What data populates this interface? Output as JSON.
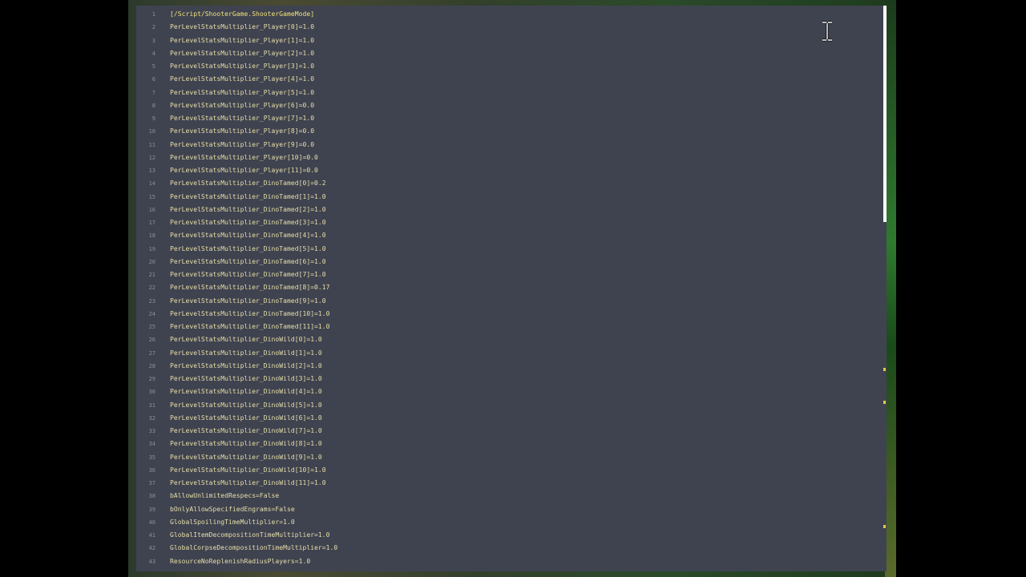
{
  "editor": {
    "lines": [
      {
        "no": "1",
        "text": "[/Script/ShooterGame.ShooterGameMode]"
      },
      {
        "no": "2",
        "text": "PerLevelStatsMultiplier_Player[0]=1.0"
      },
      {
        "no": "3",
        "text": "PerLevelStatsMultiplier_Player[1]=1.0"
      },
      {
        "no": "4",
        "text": "PerLevelStatsMultiplier_Player[2]=1.0"
      },
      {
        "no": "5",
        "text": "PerLevelStatsMultiplier_Player[3]=1.0"
      },
      {
        "no": "6",
        "text": "PerLevelStatsMultiplier_Player[4]=1.0"
      },
      {
        "no": "7",
        "text": "PerLevelStatsMultiplier_Player[5]=1.0"
      },
      {
        "no": "8",
        "text": "PerLevelStatsMultiplier_Player[6]=0.0"
      },
      {
        "no": "9",
        "text": "PerLevelStatsMultiplier_Player[7]=1.0"
      },
      {
        "no": "10",
        "text": "PerLevelStatsMultiplier_Player[8]=0.0"
      },
      {
        "no": "11",
        "text": "PerLevelStatsMultiplier_Player[9]=0.0"
      },
      {
        "no": "12",
        "text": "PerLevelStatsMultiplier_Player[10]=0.0"
      },
      {
        "no": "13",
        "text": "PerLevelStatsMultiplier_Player[11]=0.0"
      },
      {
        "no": "14",
        "text": "PerLevelStatsMultiplier_DinoTamed[0]=0.2"
      },
      {
        "no": "15",
        "text": "PerLevelStatsMultiplier_DinoTamed[1]=1.0"
      },
      {
        "no": "16",
        "text": "PerLevelStatsMultiplier_DinoTamed[2]=1.0"
      },
      {
        "no": "17",
        "text": "PerLevelStatsMultiplier_DinoTamed[3]=1.0"
      },
      {
        "no": "18",
        "text": "PerLevelStatsMultiplier_DinoTamed[4]=1.0"
      },
      {
        "no": "19",
        "text": "PerLevelStatsMultiplier_DinoTamed[5]=1.0"
      },
      {
        "no": "20",
        "text": "PerLevelStatsMultiplier_DinoTamed[6]=1.0"
      },
      {
        "no": "21",
        "text": "PerLevelStatsMultiplier_DinoTamed[7]=1.0"
      },
      {
        "no": "22",
        "text": "PerLevelStatsMultiplier_DinoTamed[8]=0.17"
      },
      {
        "no": "23",
        "text": "PerLevelStatsMultiplier_DinoTamed[9]=1.0"
      },
      {
        "no": "24",
        "text": "PerLevelStatsMultiplier_DinoTamed[10]=1.0"
      },
      {
        "no": "25",
        "text": "PerLevelStatsMultiplier_DinoTamed[11]=1.0"
      },
      {
        "no": "26",
        "text": "PerLevelStatsMultiplier_DinoWild[0]=1.0"
      },
      {
        "no": "27",
        "text": "PerLevelStatsMultiplier_DinoWild[1]=1.0"
      },
      {
        "no": "28",
        "text": "PerLevelStatsMultiplier_DinoWild[2]=1.0"
      },
      {
        "no": "29",
        "text": "PerLevelStatsMultiplier_DinoWild[3]=1.0"
      },
      {
        "no": "30",
        "text": "PerLevelStatsMultiplier_DinoWild[4]=1.0"
      },
      {
        "no": "31",
        "text": "PerLevelStatsMultiplier_DinoWild[5]=1.0"
      },
      {
        "no": "32",
        "text": "PerLevelStatsMultiplier_DinoWild[6]=1.0"
      },
      {
        "no": "33",
        "text": "PerLevelStatsMultiplier_DinoWild[7]=1.0"
      },
      {
        "no": "34",
        "text": "PerLevelStatsMultiplier_DinoWild[8]=1.0"
      },
      {
        "no": "35",
        "text": "PerLevelStatsMultiplier_DinoWild[9]=1.0"
      },
      {
        "no": "36",
        "text": "PerLevelStatsMultiplier_DinoWild[10]=1.0"
      },
      {
        "no": "37",
        "text": "PerLevelStatsMultiplier_DinoWild[11]=1.0"
      },
      {
        "no": "38",
        "text": "bAllowUnlimitedRespecs=False"
      },
      {
        "no": "39",
        "text": "bOnlyAllowSpecifiedEngrams=False"
      },
      {
        "no": "40",
        "text": "GlobalSpoilingTimeMultiplier=1.0"
      },
      {
        "no": "41",
        "text": "GlobalItemDecompositionTimeMultiplier=1.0"
      },
      {
        "no": "42",
        "text": "GlobalCorpseDecompositionTimeMultiplier=1.0"
      },
      {
        "no": "43",
        "text": "ResourceNoReplenishRadiusPlayers=1.0"
      }
    ]
  },
  "colors": {
    "editor_background": "#3f4350",
    "code_text": "#e8dfa8",
    "line_number": "#8a8e9b",
    "scrollbar_thumb": "#ffffff",
    "scroll_marker": "#e6c84a"
  },
  "icons": {
    "cursor": "text-cursor-ibeam-icon"
  }
}
